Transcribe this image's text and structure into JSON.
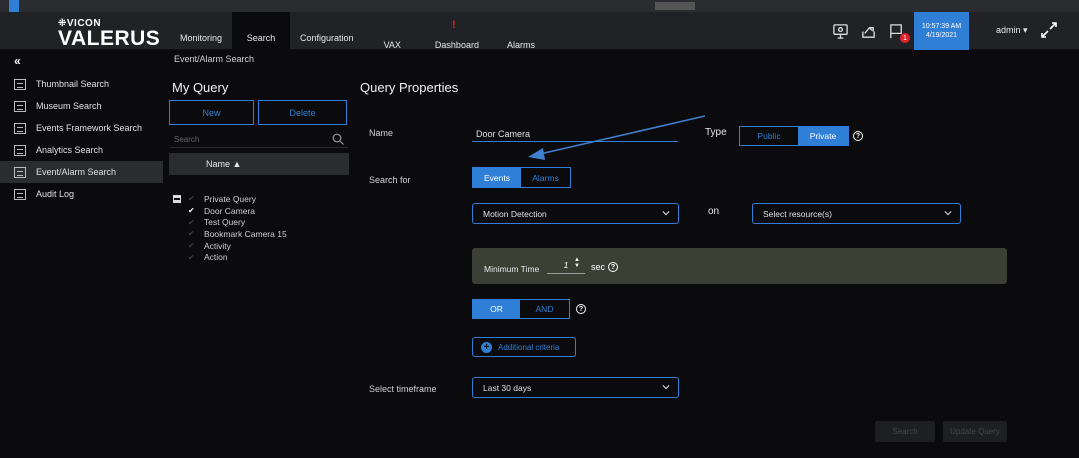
{
  "header": {
    "logo_top": "⁜VICON",
    "logo_main": "VALERUS",
    "tabs": [
      {
        "label": "Monitoring",
        "active": false
      },
      {
        "label": "Search",
        "active": true
      },
      {
        "label": "Configuration",
        "active": false
      },
      {
        "label": "VAX",
        "active": false
      },
      {
        "label": "Dashboard",
        "active": false,
        "alert": "!"
      },
      {
        "label": "Alarms",
        "active": false
      }
    ],
    "icons": [
      "monitor-icon",
      "share-icon",
      "flag-icon"
    ],
    "flag_badge": "1",
    "clock_time": "10:57:39 AM",
    "clock_date": "4/19/2021",
    "user": "admin ▾"
  },
  "sidebar": {
    "collapse": "«",
    "items": [
      {
        "label": "Thumbnail Search",
        "active": false
      },
      {
        "label": "Museum Search",
        "active": false
      },
      {
        "label": "Events Framework Search",
        "active": false
      },
      {
        "label": "Analytics Search",
        "active": false
      },
      {
        "label": "Event/Alarm Search",
        "active": true
      },
      {
        "label": "Audit Log",
        "active": false
      }
    ]
  },
  "breadcrumb": "Event/Alarm Search",
  "my_query": {
    "title": "My Query",
    "new_label": "New",
    "delete_label": "Delete",
    "search_placeholder": "Search",
    "name_header": "Name ▲",
    "group": "Private Query",
    "items": [
      {
        "label": "Door Camera",
        "checked": true
      },
      {
        "label": "Test Query",
        "checked": false
      },
      {
        "label": "Bookmark Camera 15",
        "checked": false
      },
      {
        "label": "Activity",
        "checked": false
      },
      {
        "label": "Action",
        "checked": false
      }
    ]
  },
  "query_properties": {
    "title": "Query Properties",
    "name_label": "Name",
    "name_value": "Door Camera",
    "type_label": "Type",
    "type_public": "Public",
    "type_private": "Private",
    "search_for_label": "Search for",
    "events_label": "Events",
    "alarms_label": "Alarms",
    "event_type": "Motion Detection",
    "on_label": "on",
    "resource_placeholder": "Select resource(s)",
    "min_time_label": "Minimum Time",
    "min_time_value": "1",
    "min_time_unit": "sec",
    "or_label": "OR",
    "and_label": "AND",
    "additional_label": "Additional criteria",
    "timeframe_label": "Select timeframe",
    "timeframe_value": "Last 30 days",
    "search_btn": "Search",
    "update_btn": "Update Query",
    "help": "?"
  },
  "colors": {
    "accent": "#2f7fd6",
    "alert": "#e0202a",
    "background": "#0b0b0d",
    "panel": "#2a2c30"
  }
}
